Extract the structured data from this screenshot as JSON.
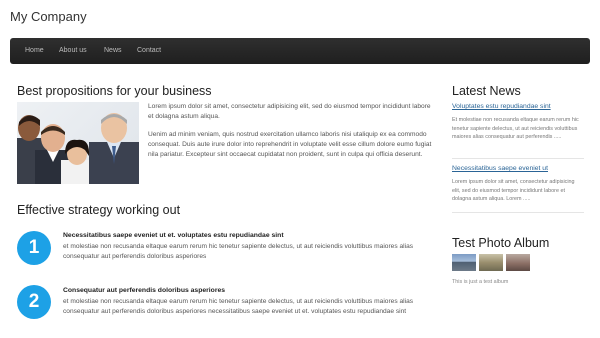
{
  "brand": "My Company",
  "nav": [
    "Home",
    "About us",
    "News",
    "Contact"
  ],
  "main": {
    "propositions": {
      "title": "Best propositions for your business",
      "para1": "Lorem ipsum dolor sit amet, consectetur adipisicing elit, sed do eiusmod tempor incididunt labore et dolagna astum aliqua.",
      "para2": "Uenim ad minim veniam, quis nostrud exercitation ullamco laboris nisi utaliquip ex ea commodo consequat. Duis aute irure dolor into reprehendrit in voluptate velit esse cillum dolore eumo fugiat nila pariatur. Excepteur sint occaecat cupidatat non proident, sunt in culpa qui officia deserunt."
    },
    "strategy": {
      "title": "Effective strategy working out",
      "steps": [
        {
          "number": "1",
          "title": "Necessitatibus saepe eveniet ut et. voluptates estu repudiandae sint",
          "text": "et molestiae non recusanda eltaque earum rerum hic tenetur sapiente delectus, ut aut reiciendis voluttibus maiores alias consequatur aut perferendis doloribus asperiores"
        },
        {
          "number": "2",
          "title": "Consequatur aut perferendis doloribus asperiores",
          "text": "et molestiae non recusanda eltaque earum rerum hic tenetur sapiente delectus, ut aut reiciendis voluttibus maiores alias consequatur aut perferendis doloribus asperiores necessitatibus saepe eveniet ut et. voluptates estu repudiandae sint"
        }
      ]
    }
  },
  "sidebar": {
    "news_title": "Latest News",
    "news": [
      {
        "title": "Voluptates estu repudiandae sint",
        "text": "Et molestiae non recusanda eltaque earum rerum hic tenetur sapiente delectus, ut aut reiciendis voluttibus maiores alias consequatur aut perferendis ....."
      },
      {
        "title": "Necessitatibus saepe eveniet ut",
        "text": "Lorem ipsum dolor sit amet, consectetur adipisicing elit, sed do eiusmod tempor incididunt labore et dolagna astum aliqua. Lorem ....."
      }
    ],
    "album_title": "Test Photo Album",
    "album_caption": "This is just a test album"
  }
}
